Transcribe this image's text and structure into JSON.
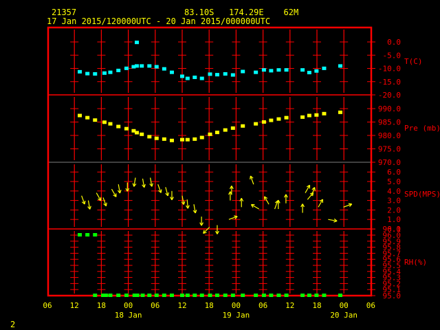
{
  "header": {
    "station": "21357",
    "location": "83.10S   174.29E    62M",
    "period": "17 Jan 2015/120000UTC - 20 Jan 2015/000000UTC"
  },
  "page_number": "2",
  "colors": {
    "axis": "#ff0000",
    "text": "#ffff00",
    "temp": "#00ffff",
    "pressure": "#ffff00",
    "wind": "#ffff00",
    "rh": "#00ff00",
    "divider": "#808080"
  },
  "chart_data": {
    "type": "scatter",
    "title": "21357 83.10S 174.29E 62M",
    "x_unit": "hours since 17 Jan 06UTC",
    "xlim": [
      0,
      72
    ],
    "x_tick_labels": [
      "06",
      "12",
      "18",
      "00",
      "06",
      "12",
      "18",
      "00",
      "06",
      "12",
      "18",
      "00",
      "06"
    ],
    "date_labels": [
      {
        "label": "18 Jan",
        "hour": 18
      },
      {
        "label": "19 Jan",
        "hour": 42
      },
      {
        "label": "20 Jan",
        "hour": 66
      }
    ],
    "panels": [
      {
        "name": "temperature",
        "label": "T(C)",
        "ylim": [
          -20,
          5
        ],
        "ticks": [
          "0.0",
          "-5.0",
          "-10.0",
          "-15.0",
          "-20.0"
        ],
        "tick_values": [
          0,
          -5,
          -10,
          -15,
          -20
        ],
        "points": [
          [
            7.2,
            -11.4
          ],
          [
            8.9,
            -12.1
          ],
          [
            10.6,
            -12.2
          ],
          [
            12.7,
            -11.9
          ],
          [
            14.0,
            -11.6
          ],
          [
            15.8,
            -10.9
          ],
          [
            17.6,
            -10.1
          ],
          [
            19.2,
            -9.5
          ],
          [
            19.9,
            -0.3
          ],
          [
            19.9,
            -9.2
          ],
          [
            21.0,
            -9.2
          ],
          [
            22.7,
            -9.2
          ],
          [
            24.3,
            -9.5
          ],
          [
            26.0,
            -10.3
          ],
          [
            27.7,
            -11.6
          ],
          [
            30.0,
            -13.1
          ],
          [
            31.2,
            -13.9
          ],
          [
            32.8,
            -13.5
          ],
          [
            34.4,
            -13.9
          ],
          [
            36.2,
            -12.3
          ],
          [
            37.8,
            -12.5
          ],
          [
            39.6,
            -12.2
          ],
          [
            41.3,
            -12.6
          ],
          [
            43.5,
            -11.3
          ],
          [
            46.4,
            -11.6
          ],
          [
            48.2,
            -10.7
          ],
          [
            49.8,
            -11.0
          ],
          [
            51.5,
            -10.7
          ],
          [
            53.2,
            -10.7
          ],
          [
            56.8,
            -10.7
          ],
          [
            58.3,
            -11.7
          ],
          [
            59.9,
            -11.1
          ],
          [
            61.6,
            -10.1
          ],
          [
            65.2,
            -9.2
          ]
        ]
      },
      {
        "name": "pressure",
        "label": "Pre (mb)",
        "ylim": [
          970,
          995
        ],
        "ticks": [
          "990.0",
          "985.0",
          "980.0",
          "975.0",
          "970.0"
        ],
        "tick_values": [
          990,
          985,
          980,
          975,
          970
        ],
        "points": [
          [
            7.2,
            987.3
          ],
          [
            8.9,
            986.5
          ],
          [
            10.6,
            985.6
          ],
          [
            12.7,
            984.8
          ],
          [
            14.0,
            984.2
          ],
          [
            15.8,
            983.2
          ],
          [
            17.6,
            982.4
          ],
          [
            19.2,
            981.6
          ],
          [
            19.9,
            980.9
          ],
          [
            21.0,
            980.3
          ],
          [
            22.7,
            979.4
          ],
          [
            24.3,
            978.8
          ],
          [
            26.0,
            978.5
          ],
          [
            27.7,
            978.0
          ],
          [
            30.0,
            978.3
          ],
          [
            31.2,
            978.3
          ],
          [
            32.8,
            978.5
          ],
          [
            34.4,
            979.1
          ],
          [
            36.2,
            980.3
          ],
          [
            37.8,
            981.0
          ],
          [
            39.6,
            981.9
          ],
          [
            41.3,
            982.6
          ],
          [
            43.5,
            983.4
          ],
          [
            46.4,
            984.2
          ],
          [
            48.2,
            984.9
          ],
          [
            49.8,
            985.5
          ],
          [
            51.5,
            986.0
          ],
          [
            53.2,
            986.5
          ],
          [
            56.8,
            986.7
          ],
          [
            58.3,
            987.3
          ],
          [
            59.9,
            987.5
          ],
          [
            61.6,
            988.0
          ],
          [
            65.2,
            988.5
          ]
        ]
      },
      {
        "name": "wind_speed",
        "label": "SPD(MPS)",
        "ylim": [
          0,
          7
        ],
        "ticks": [
          "6.0",
          "5.0",
          "4.0",
          "3.0",
          "2.0",
          "1.0",
          "0.0"
        ],
        "tick_values": [
          6,
          5,
          4,
          3,
          2,
          1,
          0
        ],
        "points_hour_speed_heading": [
          [
            7.6,
            3.5,
            160
          ],
          [
            9.1,
            3.0,
            170
          ],
          [
            10.9,
            3.8,
            150
          ],
          [
            12.4,
            3.3,
            160
          ],
          [
            14.3,
            4.2,
            150
          ],
          [
            15.8,
            4.7,
            170
          ],
          [
            17.8,
            4.9,
            180
          ],
          [
            19.6,
            5.4,
            190
          ],
          [
            21.2,
            5.3,
            170
          ],
          [
            22.9,
            5.4,
            170
          ],
          [
            24.6,
            4.7,
            160
          ],
          [
            26.3,
            4.4,
            165
          ],
          [
            27.7,
            4.0,
            180
          ],
          [
            30.0,
            3.5,
            170
          ],
          [
            31.1,
            3.1,
            175
          ],
          [
            32.6,
            2.6,
            170
          ],
          [
            34.3,
            1.3,
            180
          ],
          [
            36.1,
            0.2,
            225
          ],
          [
            37.8,
            0.4,
            180
          ],
          [
            40.4,
            1.0,
            70
          ],
          [
            40.7,
            3.0,
            0
          ],
          [
            41.0,
            3.6,
            0
          ],
          [
            43.2,
            2.3,
            0
          ],
          [
            45.9,
            4.7,
            340
          ],
          [
            47.1,
            2.1,
            300
          ],
          [
            49.3,
            2.6,
            330
          ],
          [
            50.6,
            2.1,
            20
          ],
          [
            51.4,
            2.1,
            0
          ],
          [
            53.1,
            2.7,
            0
          ],
          [
            56.8,
            1.7,
            0
          ],
          [
            57.4,
            3.8,
            30
          ],
          [
            57.9,
            3.1,
            40
          ],
          [
            58.8,
            3.5,
            20
          ],
          [
            60.3,
            2.3,
            30
          ],
          [
            62.5,
            1.0,
            100
          ],
          [
            65.9,
            2.3,
            70
          ]
        ]
      },
      {
        "name": "relative_humidity",
        "label": "RH(%)",
        "ylim": [
          95.0,
          96.1
        ],
        "ticks": [
          "96.1",
          "96.0",
          "95.9",
          "95.8",
          "95.7",
          "95.6",
          "95.5",
          "95.4",
          "95.3",
          "95.2",
          "95.1",
          "95.0"
        ],
        "tick_values": [
          96.1,
          96.0,
          95.9,
          95.8,
          95.7,
          95.6,
          95.5,
          95.4,
          95.3,
          95.2,
          95.1,
          95.0
        ],
        "points": [
          [
            7.2,
            96.0
          ],
          [
            8.9,
            96.0
          ],
          [
            10.6,
            96.0
          ],
          [
            10.6,
            95.0
          ],
          [
            12.4,
            95.0
          ],
          [
            13.0,
            95.0
          ],
          [
            14.0,
            95.0
          ],
          [
            15.8,
            95.0
          ],
          [
            17.6,
            95.0
          ],
          [
            19.4,
            95.0
          ],
          [
            20.0,
            95.0
          ],
          [
            21.2,
            95.0
          ],
          [
            22.7,
            95.0
          ],
          [
            24.3,
            95.0
          ],
          [
            26.0,
            95.0
          ],
          [
            27.7,
            95.0
          ],
          [
            30.0,
            95.0
          ],
          [
            31.2,
            95.0
          ],
          [
            32.8,
            95.0
          ],
          [
            34.4,
            95.0
          ],
          [
            36.2,
            95.0
          ],
          [
            37.8,
            95.0
          ],
          [
            39.6,
            95.0
          ],
          [
            41.3,
            95.0
          ],
          [
            43.5,
            95.0
          ],
          [
            46.4,
            95.0
          ],
          [
            48.2,
            95.0
          ],
          [
            49.8,
            95.0
          ],
          [
            51.5,
            95.0
          ],
          [
            53.2,
            95.0
          ],
          [
            56.8,
            95.0
          ],
          [
            58.3,
            95.0
          ],
          [
            59.9,
            95.0
          ],
          [
            61.6,
            95.0
          ],
          [
            65.2,
            95.0
          ]
        ]
      }
    ]
  }
}
